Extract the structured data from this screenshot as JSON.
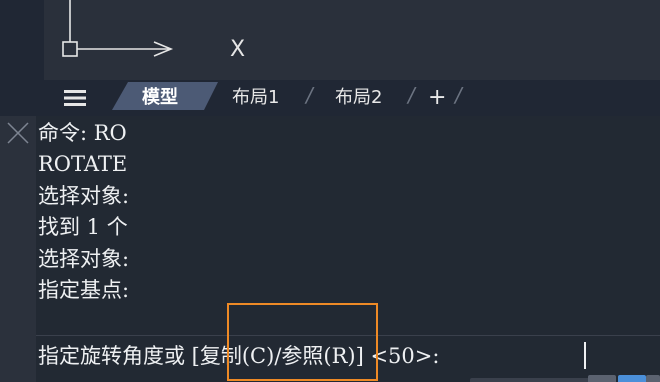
{
  "viewport": {
    "axis_x_label": "X"
  },
  "tabs": {
    "menu_icon": "hamburger-icon",
    "items": [
      {
        "label": "模型",
        "active": true
      },
      {
        "label": "布局1",
        "active": false
      },
      {
        "label": "布局2",
        "active": false
      }
    ],
    "add_label": "+"
  },
  "command": {
    "close_icon": "close-icon",
    "history": [
      "命令: RO",
      "ROTATE",
      "选择对象:",
      "找到 1 个",
      "选择对象:",
      "指定基点:"
    ],
    "prompt": "指定旋转角度或 [复制(C)/参照(R)] <50>:"
  },
  "colors": {
    "highlight": "#ee8a26",
    "active_tab": "#4c5a75"
  }
}
